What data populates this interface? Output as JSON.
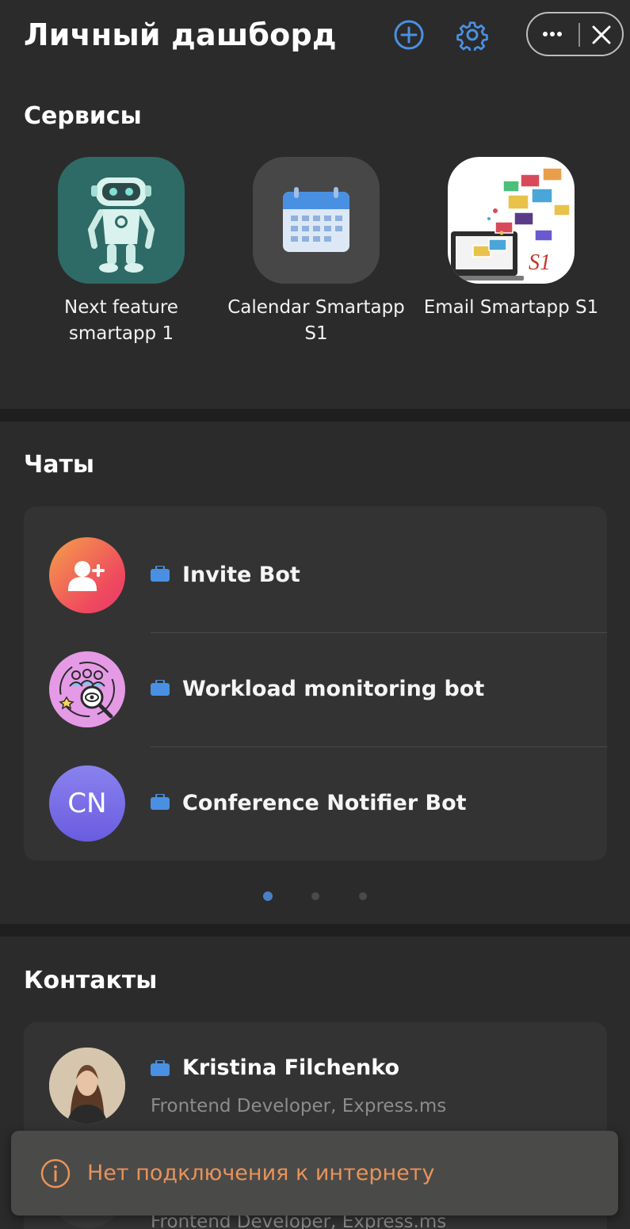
{
  "header": {
    "title": "Личный дашборд",
    "icons": [
      "add-circle-icon",
      "gear-icon",
      "more-dots-icon",
      "close-icon"
    ],
    "accent_color": "#4a90e2"
  },
  "services": {
    "title": "Сервисы",
    "items": [
      {
        "label": "Next feature smartapp 1",
        "icon": "robot-icon"
      },
      {
        "label": "Calendar Smartapp S1",
        "icon": "calendar-icon"
      },
      {
        "label": "Email Smartapp S1",
        "icon": "email-envelopes-icon"
      }
    ]
  },
  "chats": {
    "title": "Чаты",
    "items": [
      {
        "name": "Invite Bot",
        "avatar_icon": "add-user-icon"
      },
      {
        "name": "Workload monitoring bot",
        "avatar_icon": "team-search-icon"
      },
      {
        "name": "Conference Notifier Bot",
        "avatar_initials": "CN"
      }
    ],
    "pager": {
      "pages": 3,
      "active": 1
    }
  },
  "contacts": {
    "title": "Контакты",
    "items": [
      {
        "name": "Kristina Filchenko",
        "role": "Frontend Developer, Express.ms"
      },
      {
        "name": "",
        "role": "Frontend Developer, Express.ms"
      }
    ]
  },
  "toast": {
    "text": "Нет подключения к интернету",
    "icon": "info-circle-icon",
    "color": "#e8935a"
  }
}
